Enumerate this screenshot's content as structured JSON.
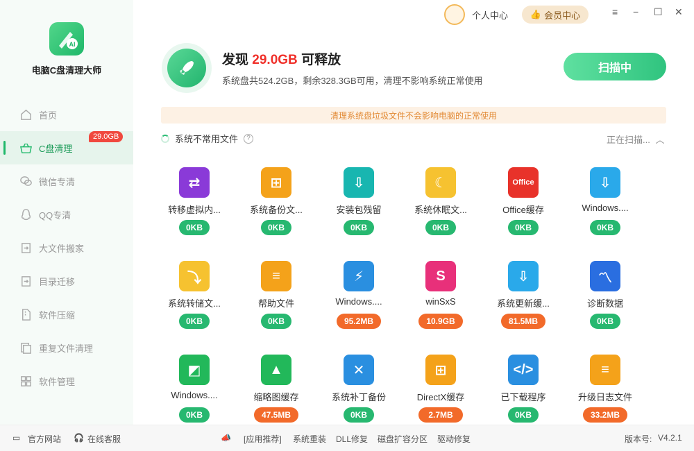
{
  "app": {
    "name": "电脑C盘清理大师",
    "version_label": "版本号:",
    "version": "V4.2.1"
  },
  "topbar": {
    "user_center": "个人中心",
    "vip_center": "会员中心",
    "minimize": "−",
    "maximize": "☐",
    "close": "✕",
    "menu": "≡"
  },
  "sidebar": {
    "items": [
      {
        "label": "首页",
        "icon": "home-icon"
      },
      {
        "label": "C盘清理",
        "icon": "basket-icon",
        "badge": "29.0GB",
        "active": true
      },
      {
        "label": "微信专清",
        "icon": "wechat-icon"
      },
      {
        "label": "QQ专清",
        "icon": "qq-icon"
      },
      {
        "label": "大文件搬家",
        "icon": "move-icon"
      },
      {
        "label": "目录迁移",
        "icon": "folder-migrate-icon"
      },
      {
        "label": "软件压缩",
        "icon": "compress-icon"
      },
      {
        "label": "重复文件清理",
        "icon": "duplicate-icon"
      },
      {
        "label": "软件管理",
        "icon": "apps-icon"
      }
    ]
  },
  "header": {
    "found_prefix": "发现",
    "found_size": "29.0GB",
    "found_suffix": "可释放",
    "subtitle": "系统盘共524.2GB，剩余328.3GB可用，清理不影响系统正常使用",
    "scan_button": "扫描中"
  },
  "notice": "清理系统盘垃圾文件不会影响电脑的正常使用",
  "section": {
    "title": "系统不常用文件",
    "help": "?",
    "status": "正在扫描..."
  },
  "items": [
    {
      "label": "转移虚拟内...",
      "size": "0KB",
      "color": "#8a3ad8",
      "icon": "virtual-memory-icon",
      "glyph": "⇄"
    },
    {
      "label": "系统备份文...",
      "size": "0KB",
      "color": "#f4a21a",
      "icon": "backup-folder-icon",
      "glyph": "⊞"
    },
    {
      "label": "安装包残留",
      "size": "0KB",
      "color": "#18b6b0",
      "icon": "installer-icon",
      "glyph": "⇩"
    },
    {
      "label": "系统休眠文...",
      "size": "0KB",
      "color": "#f6c230",
      "icon": "sleep-folder-icon",
      "glyph": "☾"
    },
    {
      "label": "Office缓存",
      "size": "0KB",
      "color": "#e8322a",
      "icon": "office-icon",
      "glyph": "Office"
    },
    {
      "label": "Windows....",
      "size": "0KB",
      "color": "#2aa9ea",
      "icon": "cloud-download-icon",
      "glyph": "⇩"
    },
    {
      "label": "系统转储文...",
      "size": "0KB",
      "color": "#f6c230",
      "icon": "dump-folder-icon",
      "glyph": "⤵"
    },
    {
      "label": "帮助文件",
      "size": "0KB",
      "color": "#f4a21a",
      "icon": "help-folder-icon",
      "glyph": "≡"
    },
    {
      "label": "Windows....",
      "size": "95.2MB",
      "color": "#2a8fe0",
      "icon": "monitor-shield-icon",
      "glyph": "⚡"
    },
    {
      "label": "winSxS",
      "size": "10.9GB",
      "color": "#e8307a",
      "icon": "winsxs-icon",
      "glyph": "S"
    },
    {
      "label": "系统更新缓...",
      "size": "81.5MB",
      "color": "#2aa9ea",
      "icon": "update-cloud-icon",
      "glyph": "⇩"
    },
    {
      "label": "诊断数据",
      "size": "0KB",
      "color": "#2a6ee0",
      "icon": "diagnostic-icon",
      "glyph": "〽"
    },
    {
      "label": "Windows....",
      "size": "0KB",
      "color": "#22b85a",
      "icon": "defender-shield-icon",
      "glyph": "◩"
    },
    {
      "label": "缩略图缓存",
      "size": "47.5MB",
      "color": "#22b85a",
      "icon": "thumbnail-icon",
      "glyph": "▲"
    },
    {
      "label": "系统补丁备份",
      "size": "0KB",
      "color": "#2a8fe0",
      "icon": "tools-icon",
      "glyph": "✕"
    },
    {
      "label": "DirectX缓存",
      "size": "2.7MB",
      "color": "#f4a21a",
      "icon": "directx-folder-icon",
      "glyph": "⊞"
    },
    {
      "label": "已下载程序",
      "size": "0KB",
      "color": "#2a8fe0",
      "icon": "code-file-icon",
      "glyph": "</>"
    },
    {
      "label": "升级日志文件",
      "size": "33.2MB",
      "color": "#f4a21a",
      "icon": "log-file-icon",
      "glyph": "≡"
    }
  ],
  "footer": {
    "official_site": "官方网站",
    "online_service": "在线客服",
    "recommend": "[应用推荐]",
    "links": [
      "系统重装",
      "DLL修复",
      "磁盘扩容分区",
      "驱动修复"
    ]
  }
}
